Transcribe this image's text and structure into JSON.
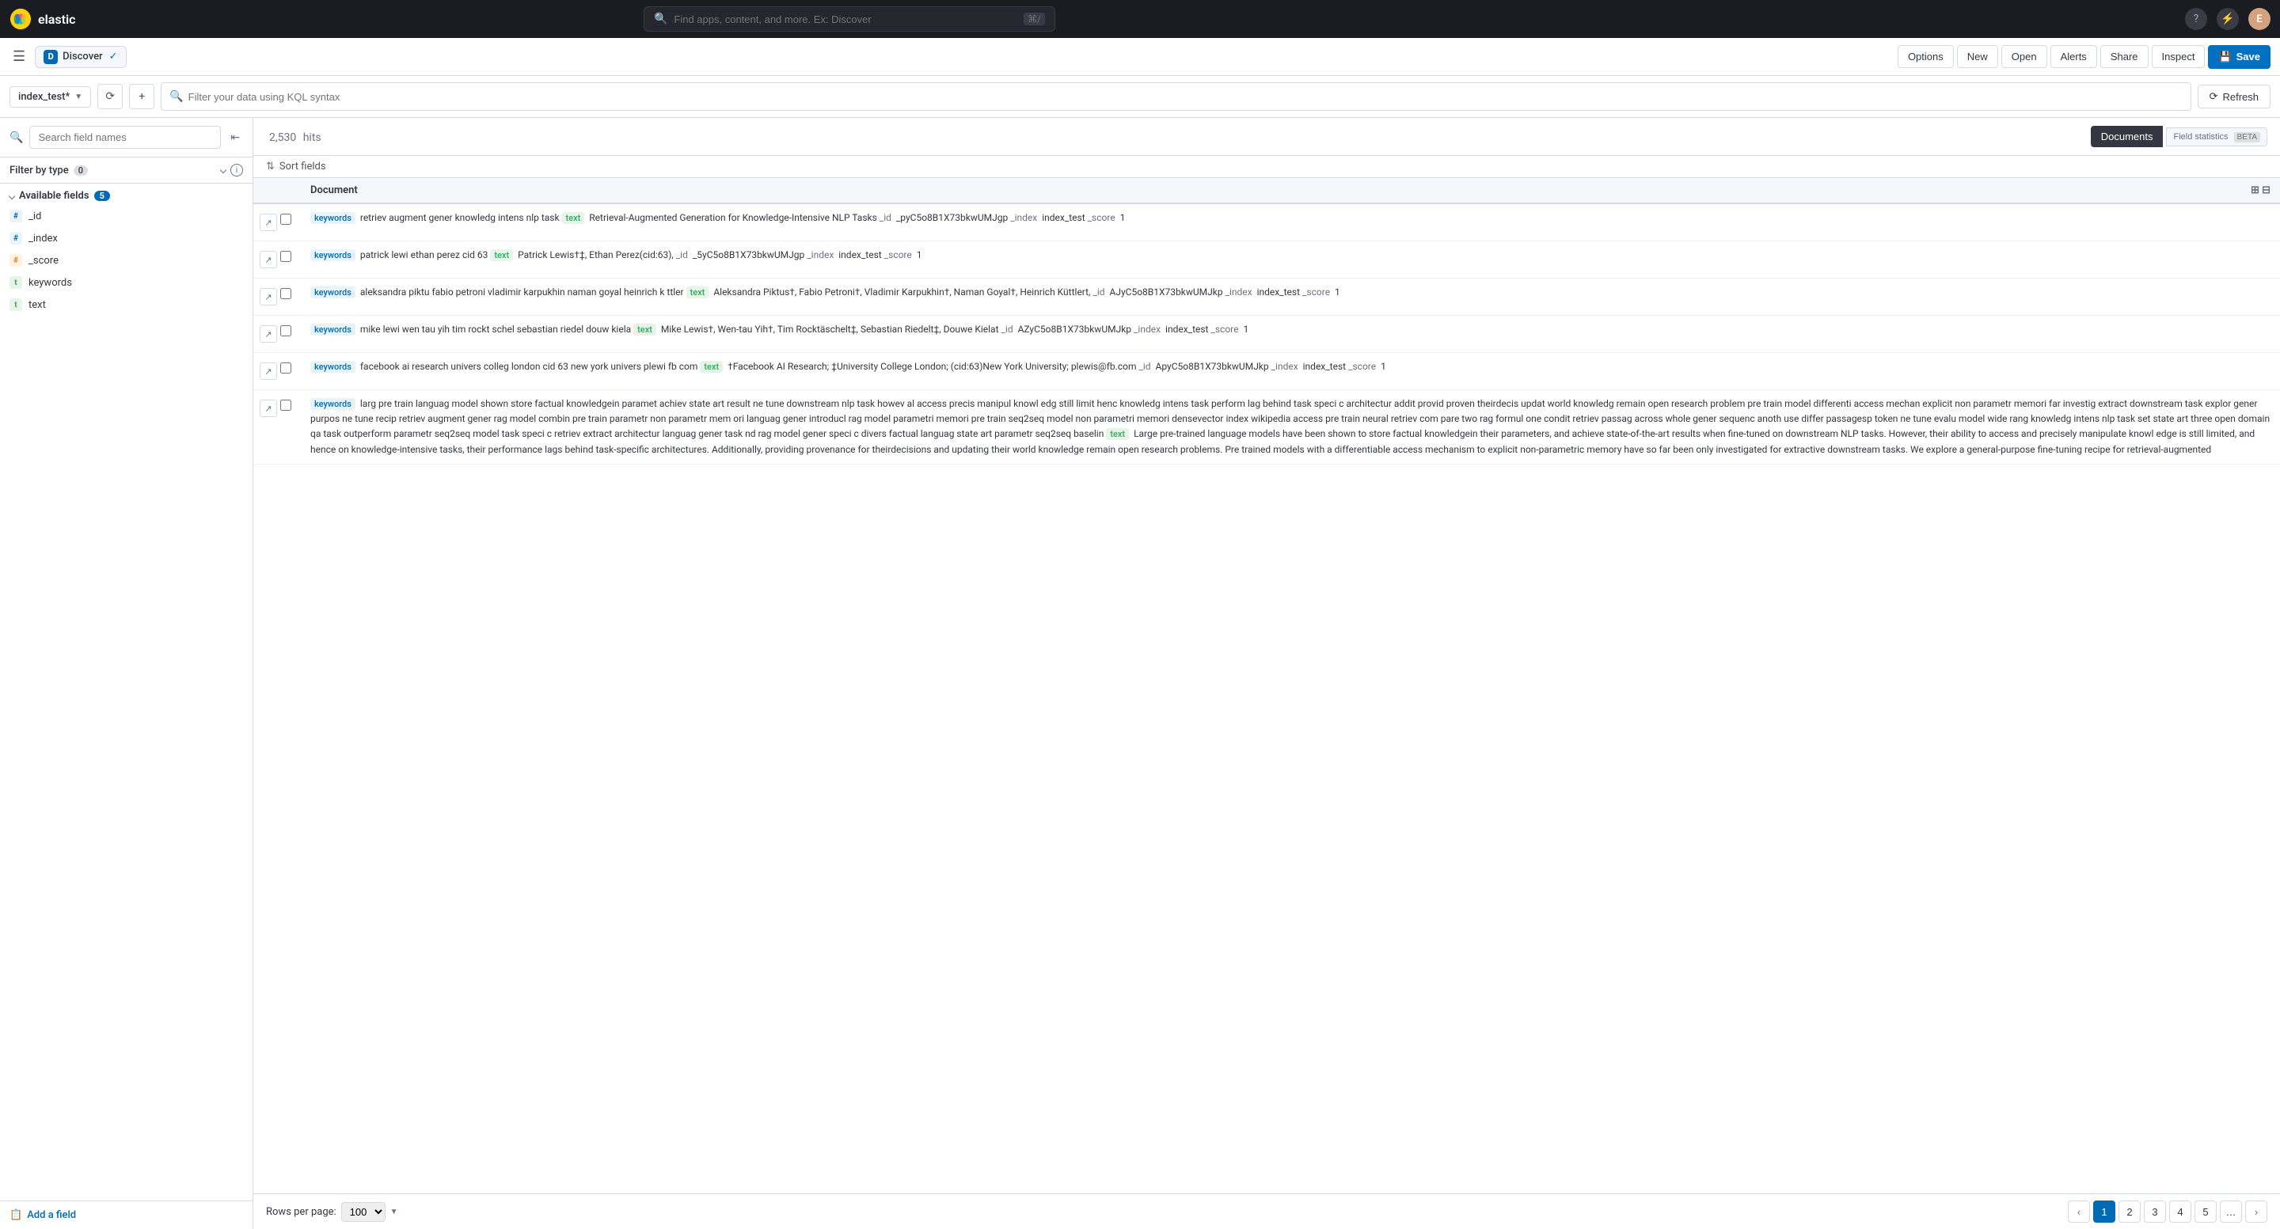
{
  "topNav": {
    "logoText": "elastic",
    "searchPlaceholder": "Find apps, content, and more. Ex: Discover",
    "searchHint": "⌘/",
    "helpIcon": "help-icon",
    "notificationsIcon": "notifications-icon",
    "userInitial": "E"
  },
  "appBar": {
    "appTabDot": "D",
    "appTabName": "Discover",
    "optionsLabel": "Options",
    "newLabel": "New",
    "openLabel": "Open",
    "alertsLabel": "Alerts",
    "shareLabel": "Share",
    "inspectLabel": "Inspect",
    "saveLabel": "Save"
  },
  "filterBar": {
    "indexName": "index_test*",
    "kqlPlaceholder": "Filter your data using KQL syntax",
    "refreshLabel": "Refresh"
  },
  "sidebar": {
    "searchPlaceholder": "Search field names",
    "filterByTypeLabel": "Filter by type",
    "filterByTypeCount": "0",
    "availableFieldsLabel": "Available fields",
    "availableFieldsCount": "5",
    "fields": [
      {
        "name": "_id",
        "type": "id",
        "typeIcon": "#"
      },
      {
        "name": "_index",
        "type": "id",
        "typeIcon": "#"
      },
      {
        "name": "_score",
        "type": "num",
        "typeIcon": "#"
      },
      {
        "name": "keywords",
        "type": "text",
        "typeIcon": "t"
      },
      {
        "name": "text",
        "type": "text",
        "typeIcon": "t"
      }
    ],
    "addFieldLabel": "Add a field"
  },
  "content": {
    "hitsCount": "2,530",
    "hitsLabel": "hits",
    "documentsLabel": "Documents",
    "fieldStatisticsLabel": "Field statistics",
    "fieldStatisticsBadge": "BETA",
    "sortFieldsLabel": "Sort fields",
    "tableHeader": "Document",
    "rows": [
      {
        "doc": "keywords retriev augment gener knowledg intens nlp task text  Retrieval-Augmented Generation for Knowledge-Intensive NLP Tasks _id _pyC5o8B1X73bkwUMJgp _index index_test _score 1"
      },
      {
        "doc": "keywords patrick lewi ethan perez cid 63 text  Patrick Lewis†‡, Ethan Perez(cid:63), _id _5yC5o8B1X73bkwUMJgp _index index_test _score 1"
      },
      {
        "doc": "keywords aleksandra piktu fabio petroni vladimir karpukhin naman goyal heinrich k ttler text  Aleksandra Piktus†, Fabio Petroni†, Vladimir Karpukhin†, Naman Goyal†, Heinrich Küttlert, _id AJyC5o8B1X73bkwUMJkp _index index_test _score 1"
      },
      {
        "doc": "keywords mike lewi wen tau yih tim rockt schel sebastian riedel douw kiela text  Mike Lewis†, Wen-tau Yih†, Tim Rocktäschelt‡, Sebastian Riedelt‡, Douwe Kielat _id AZyC5o8B1X73bkwUMJkp _index index_test _score 1"
      },
      {
        "doc": "keywords facebook ai research univers colleg london cid 63 new york univers plewi fb com text  †Facebook AI Research; ‡University College London; (cid:63)New York University; plewis@fb.com _id ApyC5o8B1X73bkwUMJkp _index index_test _score 1"
      },
      {
        "doc": "keywords larg pre train languag model shown store factual knowledgein paramet achiev state art result ne tune downstream nlp task howev al access precis manipul knowl edg still limit henc knowledg intens task perform lag behind task speci c architectur addit provid proven theirdecis updat world knowledg remain open research problem pre train model differenti access mechan explicit non parametr memori far investig extract downstream task explor gener purpos ne tune recip retriev augment gener rag model combin pre train parametr non parametr mem ori languag gener introducl rag model parametri memori pre train seq2seq model non parametri memori densevector index wikipedia access pre train neural retriev com pare two rag formul one condit retriev passag across whole gener sequenc anoth use differ passagesp token ne tune evalu model wide rang knowledg intens nlp task set state art three open domain qa task outperform parametr seq2seq model task speci c retriev extract architectur languag gener task nd rag model gener speci c divers factual languag state art parametr seq2seq baselin text  Large pre-trained language models have been shown to store factual knowledgein their parameters, and achieve state-of-the-art results when fine-tuned on downstream NLP tasks. However, their ability to access and precisely manipulate knowl edge is still limited, and hence on knowledge-intensive tasks, their performance lags behind task-specific architectures. Additionally, providing provenance for theirdecisions and updating their world knowledge remain open research problems. Pre trained models with a differentiable access mechanism to explicit non-parametric memory have so far been only investigated for extractive downstream tasks. We explore a general-purpose fine-tuning recipe for retrieval-augmented"
      }
    ],
    "pagination": {
      "rowsPerPageLabel": "Rows per page:",
      "rowsPerPageValue": "100",
      "pages": [
        "1",
        "2",
        "3",
        "4",
        "5",
        "..."
      ]
    }
  }
}
